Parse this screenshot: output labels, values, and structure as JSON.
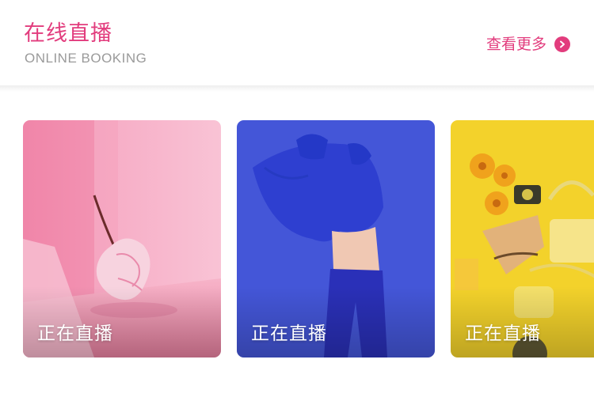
{
  "section": {
    "title": "在线直播",
    "subtitle": "ONLINE BOOKING",
    "more_label": "查看更多",
    "accent_color": "#e23c7d",
    "more_icon": "chevron-right-circle-icon"
  },
  "cards": [
    {
      "label": "正在直播",
      "theme": "pink-flower",
      "background": "#f6a9c2"
    },
    {
      "label": "正在直播",
      "theme": "blue-fashion",
      "background": "#3d4fd6"
    },
    {
      "label": "正在直播",
      "theme": "yellow-accessories",
      "background": "#f3d22b"
    }
  ]
}
